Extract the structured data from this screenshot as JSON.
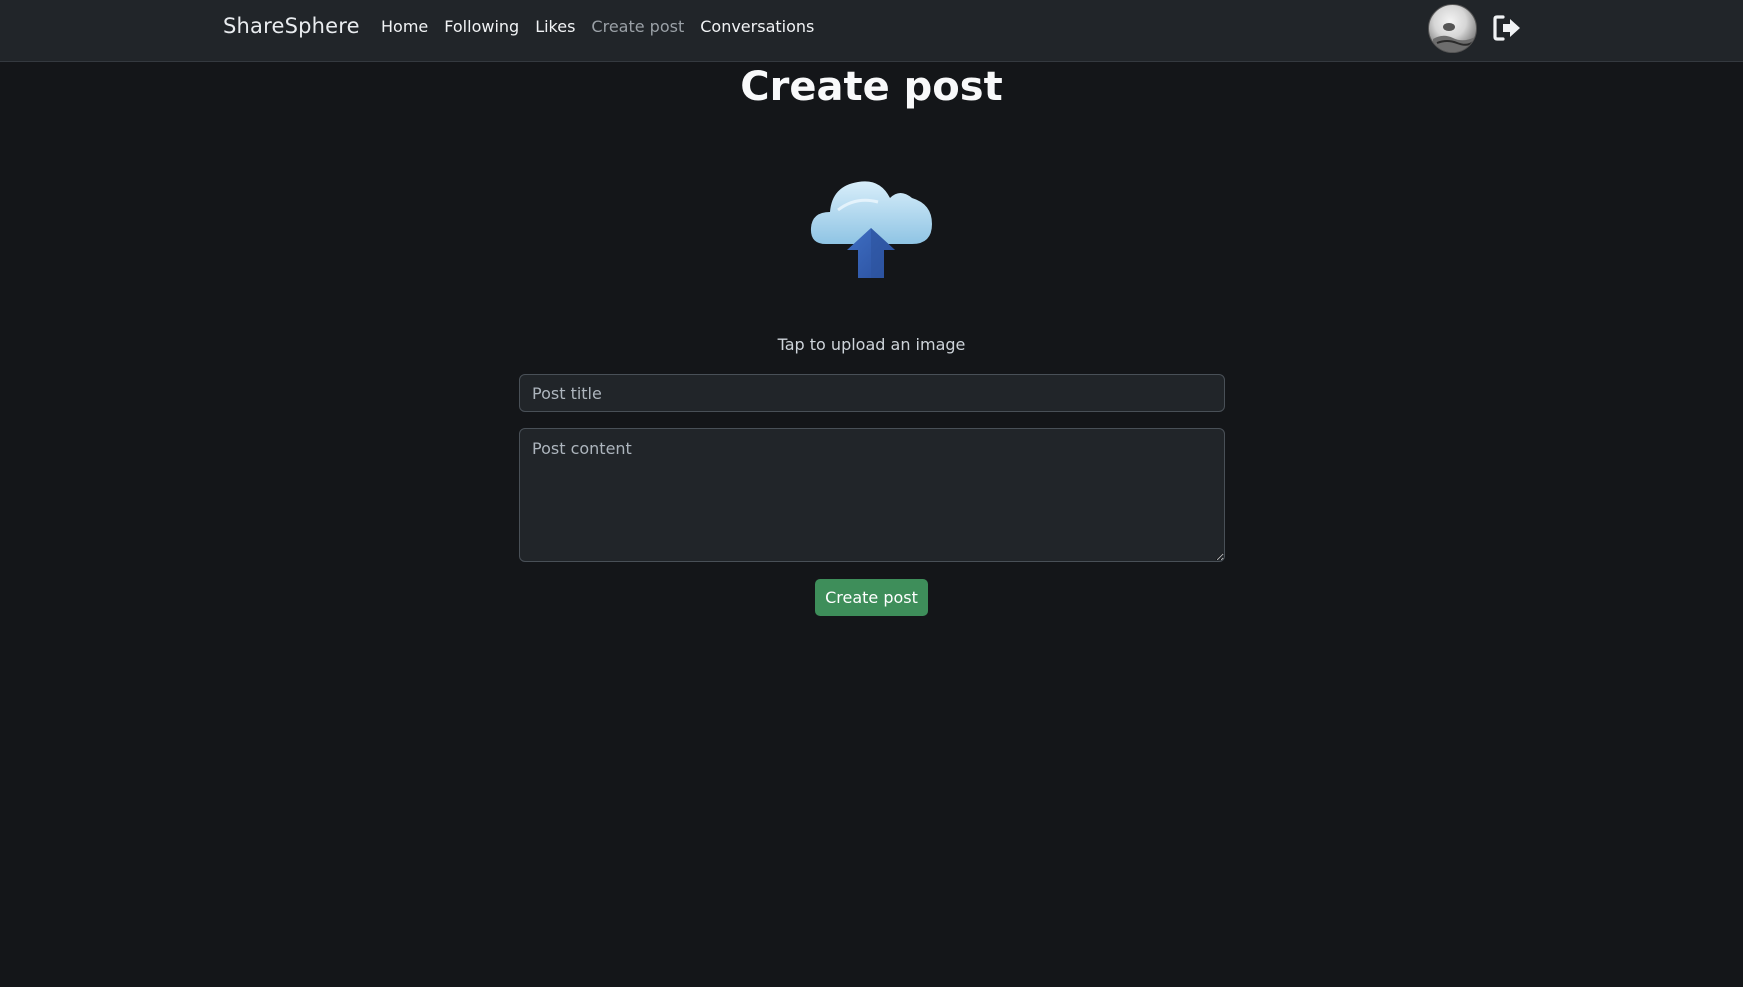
{
  "navbar": {
    "brand": "ShareSphere",
    "links": [
      {
        "label": "Home",
        "active": false
      },
      {
        "label": "Following",
        "active": false
      },
      {
        "label": "Likes",
        "active": false
      },
      {
        "label": "Create post",
        "active": true
      },
      {
        "label": "Conversations",
        "active": false
      }
    ],
    "avatar_icon": "user-avatar",
    "logout_icon": "logout-icon"
  },
  "main": {
    "title": "Create post",
    "upload_icon": "cloud-upload-icon",
    "upload_caption": "Tap to upload an image",
    "title_placeholder": "Post title",
    "content_placeholder": "Post content",
    "submit_label": "Create post"
  },
  "colors": {
    "background": "#141619",
    "navbar": "#212529",
    "submit_button": "#3e8e5a",
    "active_link": "#9aa0a6"
  }
}
